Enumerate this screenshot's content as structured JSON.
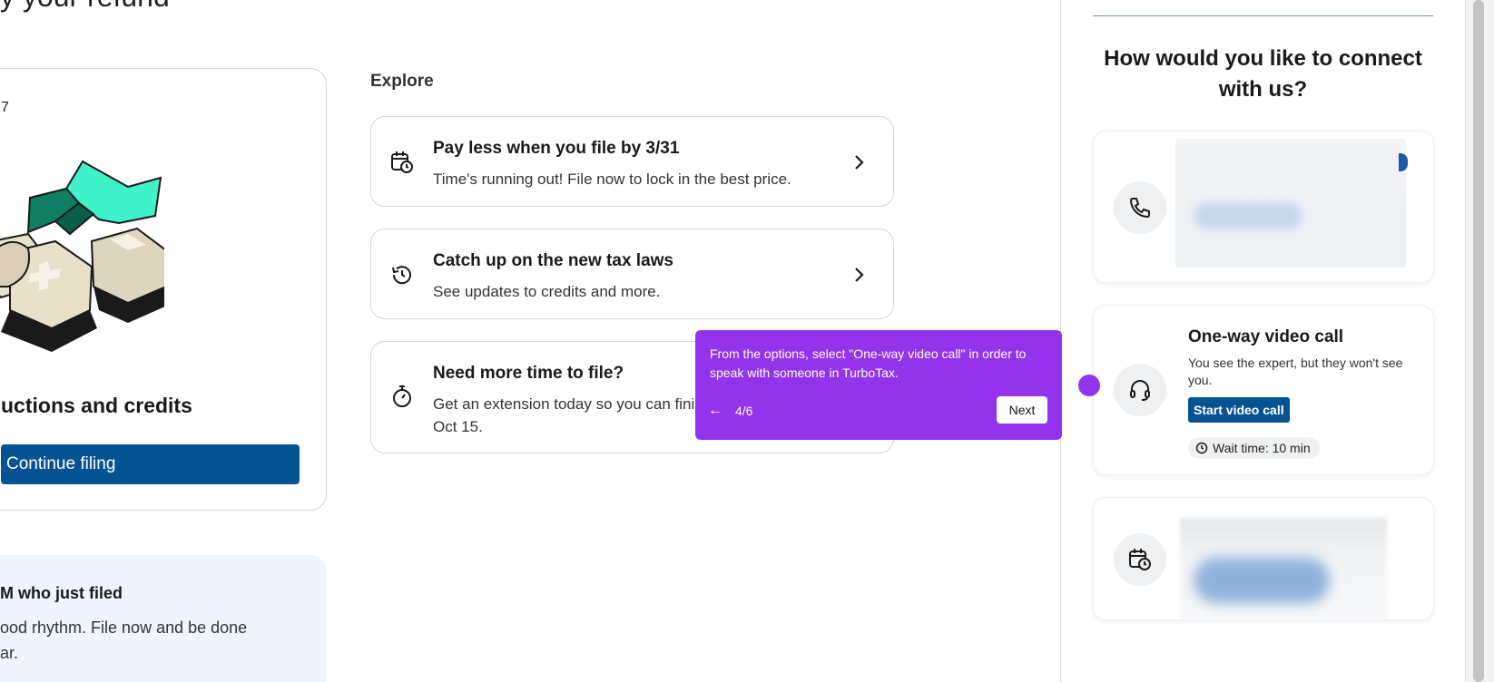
{
  "page": {
    "heading_fragment": "y your refund"
  },
  "progress_card": {
    "step_fragment": "7",
    "section_title": "uctions and credits",
    "continue_label": "Continue filing"
  },
  "info_box": {
    "title": "M who just filed",
    "line1": "ood rhythm. File now and be done",
    "line2": "ar."
  },
  "explore": {
    "label": "Explore",
    "cards": [
      {
        "icon": "calendar-clock-icon",
        "title": "Pay less when you file by 3/31",
        "desc": "Time's running out! File now to lock in the best price."
      },
      {
        "icon": "history-icon",
        "title": "Catch up on the new tax laws",
        "desc": "See updates to credits and more."
      },
      {
        "icon": "stopwatch-icon",
        "title": "Need more time to file?",
        "desc": "Get an extension today so you can finish by Oct 15."
      }
    ]
  },
  "tooltip": {
    "text": "From the options, select \"One-way video call\" in order to speak with someone in TurboTax.",
    "back_glyph": "←",
    "step": "4/6",
    "next_label": "Next"
  },
  "connect_panel": {
    "heading": "How would you like to connect with us?",
    "options": [
      {
        "icon": "phone-icon"
      },
      {
        "icon": "headset-icon",
        "title": "One-way video call",
        "desc": "You see the expert, but they won't see you.",
        "button": "Start video call",
        "wait": "Wait time: 10 min"
      },
      {
        "icon": "calendar-clock-icon"
      }
    ]
  },
  "colors": {
    "primary_button": "#055393",
    "tooltip_bg": "#9333ea",
    "info_box_bg": "#eef5fd",
    "card_border": "#cfd8d6"
  }
}
